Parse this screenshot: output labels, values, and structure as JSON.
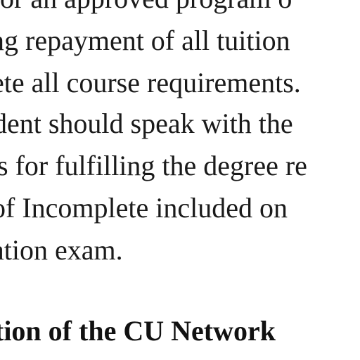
{
  "document": {
    "paragraph_lines": [
      "or an approved program o",
      "ng repayment of all tuition",
      "ete all course requirements.",
      "dent should speak with the",
      "s for fulfilling the degree re",
      "of Incomplete included on",
      "ation exam."
    ],
    "section_heading": "tion of the CU Network"
  }
}
